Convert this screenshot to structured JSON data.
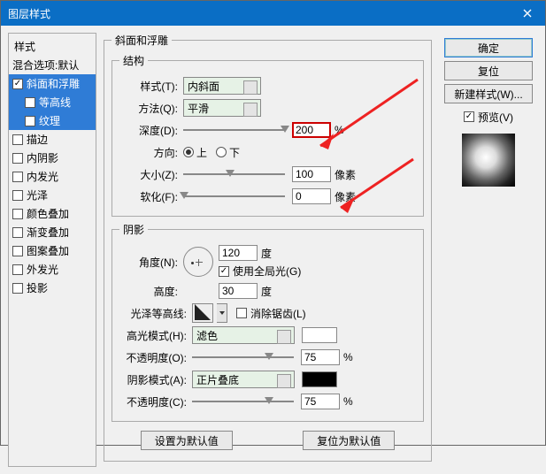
{
  "window": {
    "title": "图层样式"
  },
  "left": {
    "header": "样式",
    "blend_defaults": "混合选项:默认",
    "items": [
      {
        "label": "斜面和浮雕",
        "checked": true,
        "selected": true
      },
      {
        "label": "等高线",
        "checked": false,
        "selected": true,
        "sub": true
      },
      {
        "label": "纹理",
        "checked": false,
        "selected": true,
        "sub": true
      },
      {
        "label": "描边",
        "checked": false
      },
      {
        "label": "内阴影",
        "checked": false
      },
      {
        "label": "内发光",
        "checked": false
      },
      {
        "label": "光泽",
        "checked": false
      },
      {
        "label": "颜色叠加",
        "checked": false
      },
      {
        "label": "渐变叠加",
        "checked": false
      },
      {
        "label": "图案叠加",
        "checked": false
      },
      {
        "label": "外发光",
        "checked": false
      },
      {
        "label": "投影",
        "checked": false
      }
    ]
  },
  "bevel": {
    "group_title": "斜面和浮雕",
    "structure_title": "结构",
    "style_label": "样式(T):",
    "style_value": "内斜面",
    "technique_label": "方法(Q):",
    "technique_value": "平滑",
    "depth_label": "深度(D):",
    "depth_value": "200",
    "depth_unit": "%",
    "direction_label": "方向:",
    "up_label": "上",
    "down_label": "下",
    "size_label": "大小(Z):",
    "size_value": "100",
    "size_unit": "像素",
    "soften_label": "软化(F):",
    "soften_value": "0",
    "soften_unit": "像素"
  },
  "shading": {
    "title": "阴影",
    "angle_label": "角度(N):",
    "angle_value": "120",
    "angle_unit": "度",
    "global_label": "使用全局光(G)",
    "altitude_label": "高度:",
    "altitude_value": "30",
    "altitude_unit": "度",
    "gloss_label": "光泽等高线:",
    "antialias_label": "消除锯齿(L)",
    "highlight_mode_label": "高光模式(H):",
    "highlight_mode_value": "滤色",
    "highlight_color": "#ffffff",
    "opacity_label": "不透明度(O):",
    "highlight_opacity": "75",
    "opacity_unit": "%",
    "shadow_mode_label": "阴影模式(A):",
    "shadow_mode_value": "正片叠底",
    "shadow_color": "#000000",
    "shadow_opacity_label": "不透明度(C):",
    "shadow_opacity": "75"
  },
  "buttons": {
    "set_default": "设置为默认值",
    "reset_default": "复位为默认值"
  },
  "right": {
    "ok": "确定",
    "cancel": "复位",
    "new_style": "新建样式(W)...",
    "preview_label": "预览(V)"
  }
}
